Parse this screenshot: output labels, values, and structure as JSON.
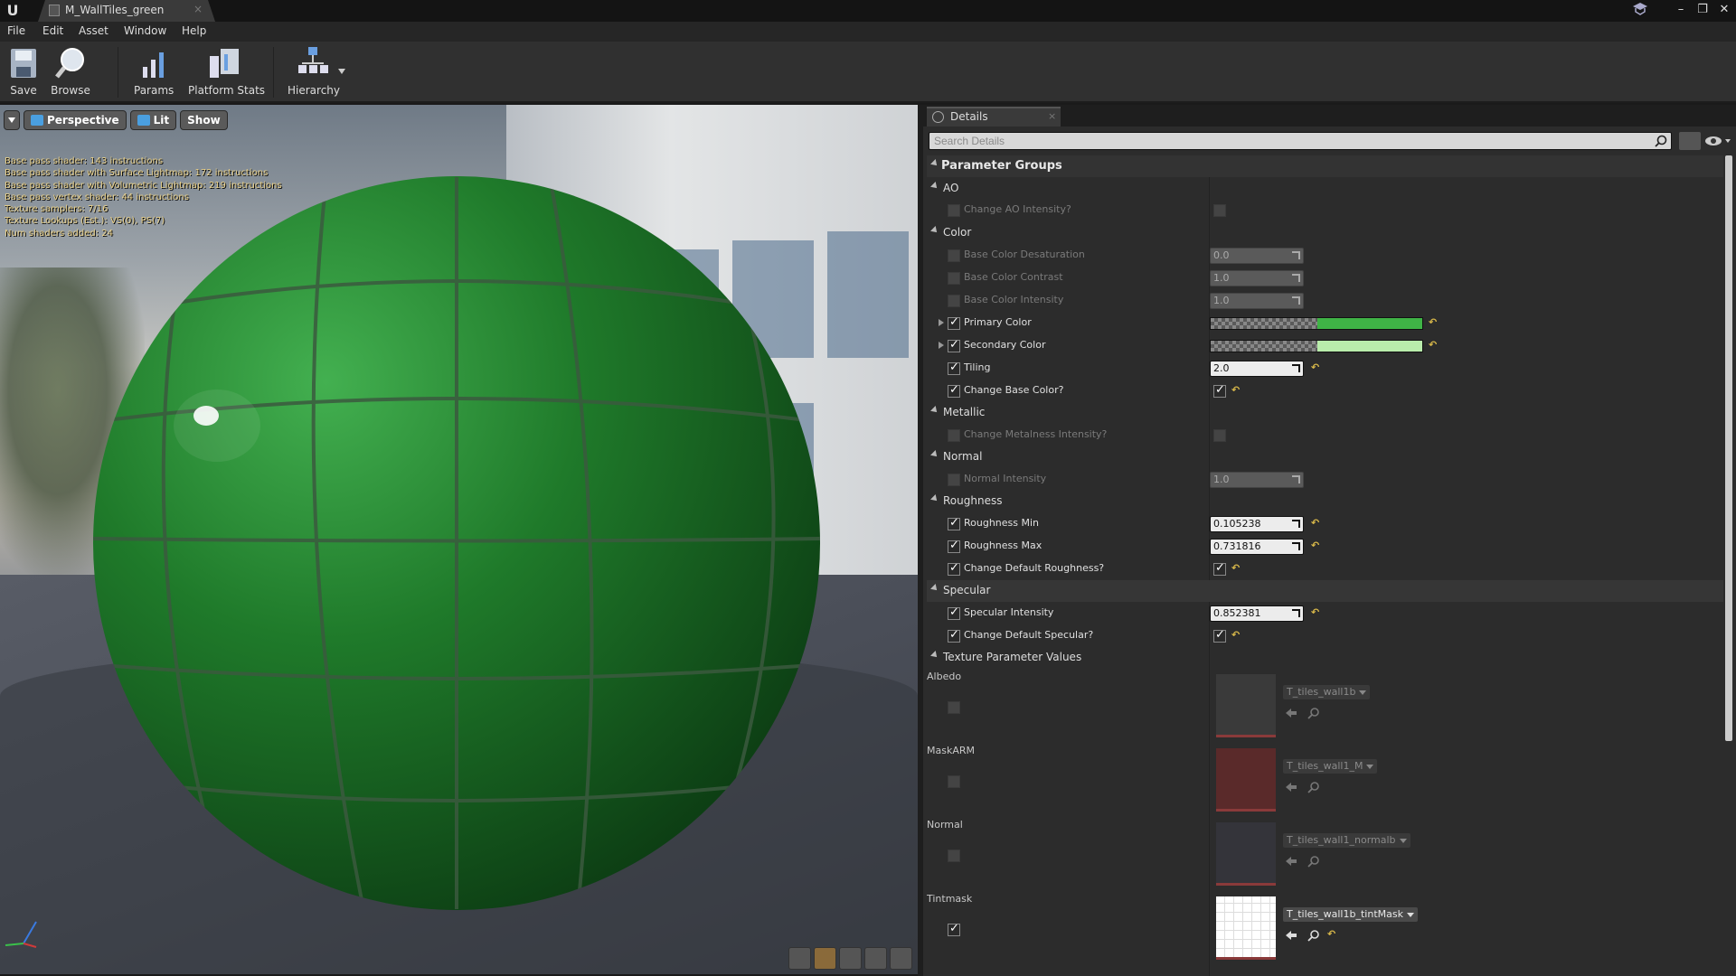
{
  "window": {
    "tab_title": "M_WallTiles_green",
    "tab_close": "×",
    "controls": [
      "–",
      "❐",
      "✕"
    ]
  },
  "menu": [
    "File",
    "Edit",
    "Asset",
    "Window",
    "Help"
  ],
  "toolbar": {
    "save": "Save",
    "browse": "Browse",
    "params": "Params",
    "platform_stats": "Platform Stats",
    "hierarchy": "Hierarchy"
  },
  "viewport": {
    "perspective": "Perspective",
    "lit": "Lit",
    "show": "Show",
    "stats": [
      "Base pass shader: 143 instructions",
      "Base pass shader with Surface Lightmap: 172 instructions",
      "Base pass shader with Volumetric Lightmap: 219 instructions",
      "Base pass vertex shader: 44 instructions",
      "Texture samplers: 7/16",
      "Texture Lookups (Est.): VS(0), PS(7)",
      "Num shaders added: 24"
    ],
    "sphere_color": "#1f7a2a"
  },
  "details": {
    "tab": "Details",
    "tab_close": "×",
    "search_placeholder": "Search Details",
    "parameter_groups": "Parameter Groups",
    "groups": {
      "ao": "AO",
      "color": "Color",
      "metallic": "Metallic",
      "normal": "Normal",
      "roughness": "Roughness",
      "specular": "Specular",
      "texture": "Texture Parameter Values"
    },
    "params": {
      "change_ao": {
        "label": "Change AO Intensity?",
        "enabled": false
      },
      "base_desat": {
        "label": "Base Color Desaturation",
        "value": "0.0",
        "enabled": false
      },
      "base_contrast": {
        "label": "Base Color Contrast",
        "value": "1.0",
        "enabled": false
      },
      "base_intensity": {
        "label": "Base Color Intensity",
        "value": "1.0",
        "enabled": false
      },
      "primary_color": {
        "label": "Primary Color",
        "enabled": true,
        "color": "#3fb346"
      },
      "secondary_color": {
        "label": "Secondary Color",
        "enabled": true,
        "color": "#b9ecab"
      },
      "tiling": {
        "label": "Tiling",
        "value": "2.0",
        "enabled": true
      },
      "change_base_color": {
        "label": "Change Base Color?",
        "enabled": true
      },
      "change_metalness": {
        "label": "Change Metalness Intensity?",
        "enabled": false
      },
      "normal_intensity": {
        "label": "Normal Intensity",
        "value": "1.0",
        "enabled": false
      },
      "roughness_min": {
        "label": "Roughness Min",
        "value": "0.105238",
        "enabled": true
      },
      "roughness_max": {
        "label": "Roughness Max",
        "value": "0.731816",
        "enabled": true
      },
      "change_default_roughness": {
        "label": "Change Default Roughness?",
        "enabled": true
      },
      "specular_intensity": {
        "label": "Specular Intensity",
        "value": "0.852381",
        "enabled": true
      },
      "change_default_specular": {
        "label": "Change Default Specular?",
        "enabled": true
      }
    },
    "textures": [
      {
        "label": "Albedo",
        "asset": "T_tiles_wall1b",
        "enabled": false,
        "thumb": "#3a3a3a"
      },
      {
        "label": "MaskARM",
        "asset": "T_tiles_wall1_M",
        "enabled": false,
        "thumb": "#5a2a2a"
      },
      {
        "label": "Normal",
        "asset": "T_tiles_wall1_normalb",
        "enabled": false,
        "thumb": "#34343a"
      },
      {
        "label": "Tintmask",
        "asset": "T_tiles_wall1b_tintMask",
        "enabled": true,
        "thumb": "#ffffff"
      }
    ],
    "reset_glyph": "↶"
  }
}
